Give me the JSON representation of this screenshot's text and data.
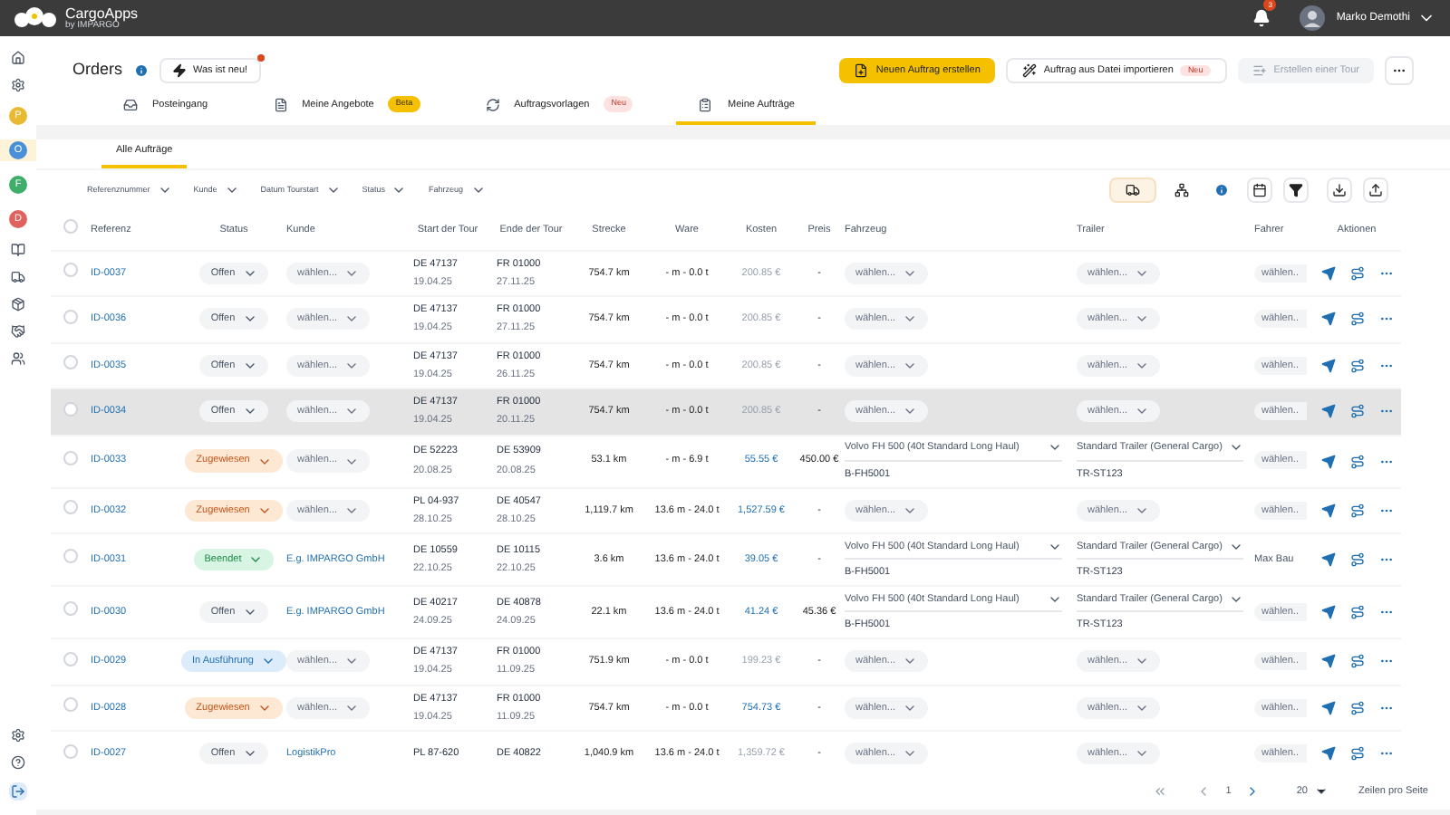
{
  "app": {
    "name": "CargoApps",
    "tagline": "by IMPARGO"
  },
  "notifications": {
    "count": "3"
  },
  "user": {
    "name": "Marko Demothi"
  },
  "sidebar": {
    "workspaces": [
      {
        "letter": "P",
        "color": "#e8b931",
        "selected": false
      },
      {
        "letter": "O",
        "color": "#4a90d9",
        "selected": true
      },
      {
        "letter": "F",
        "color": "#3fae6a",
        "selected": false
      },
      {
        "letter": "D",
        "color": "#e0625e",
        "selected": false
      }
    ]
  },
  "header": {
    "title": "Orders",
    "whats_new": "Was ist neu!",
    "new_order": "Neuen Auftrag erstellen",
    "import": {
      "label": "Auftrag aus Datei importieren",
      "badge": "Neu"
    },
    "create_tour": {
      "label": "Erstellen einer Tour",
      "disabled": true
    }
  },
  "tabs": [
    {
      "label": "Posteingang",
      "kind": "inbox",
      "selected": false
    },
    {
      "label": "Meine Angebote",
      "kind": "offers",
      "badge": {
        "text": "Beta",
        "kind": "beta"
      },
      "selected": false
    },
    {
      "label": "Auftragsvorlagen",
      "kind": "templates",
      "badge": {
        "text": "Neu",
        "kind": "new"
      },
      "selected": false
    },
    {
      "label": "Meine Aufträge",
      "kind": "orders",
      "selected": true
    }
  ],
  "subtabs": [
    {
      "label": "Alle Aufträge",
      "selected": true
    }
  ],
  "filters": [
    "Referenznummer",
    "Kunde",
    "Datum Tourstart",
    "Status",
    "Fahrzeug"
  ],
  "table": {
    "all_checked": false,
    "columns": [
      "Referenz",
      "Status",
      "Kunde",
      "Start der Tour",
      "Ende der Tour",
      "Strecke",
      "Ware",
      "Kosten",
      "Preis",
      "Fahrzeug",
      "Trailer",
      "Fahrer",
      "Aktionen"
    ],
    "rows": [
      {
        "checked": false,
        "ref": "ID-0037",
        "status": {
          "label": "Offen",
          "kind": "open"
        },
        "kunde": {
          "kind": "select",
          "text": "wählen..."
        },
        "start": [
          "DE 47137",
          "19.04.25"
        ],
        "end": [
          "FR 01000",
          "27.11.25"
        ],
        "strecke": "754.7 km",
        "ware": "- m - 0.0 t",
        "kosten": {
          "text": "200.85 €",
          "kind": "muted"
        },
        "preis": "-",
        "fahrzeug": {
          "kind": "select",
          "text": "wählen..."
        },
        "trailer": {
          "kind": "select",
          "text": "wählen..."
        },
        "fahrer": {
          "kind": "select",
          "text": "wählen.."
        },
        "highlighted": false
      },
      {
        "checked": false,
        "ref": "ID-0036",
        "status": {
          "label": "Offen",
          "kind": "open"
        },
        "kunde": {
          "kind": "select",
          "text": "wählen..."
        },
        "start": [
          "DE 47137",
          "19.04.25"
        ],
        "end": [
          "FR 01000",
          "27.11.25"
        ],
        "strecke": "754.7 km",
        "ware": "- m - 0.0 t",
        "kosten": {
          "text": "200.85 €",
          "kind": "muted"
        },
        "preis": "-",
        "fahrzeug": {
          "kind": "select",
          "text": "wählen..."
        },
        "trailer": {
          "kind": "select",
          "text": "wählen..."
        },
        "fahrer": {
          "kind": "select",
          "text": "wählen.."
        },
        "highlighted": false
      },
      {
        "checked": false,
        "ref": "ID-0035",
        "status": {
          "label": "Offen",
          "kind": "open"
        },
        "kunde": {
          "kind": "select",
          "text": "wählen..."
        },
        "start": [
          "DE 47137",
          "19.04.25"
        ],
        "end": [
          "FR 01000",
          "26.11.25"
        ],
        "strecke": "754.7 km",
        "ware": "- m - 0.0 t",
        "kosten": {
          "text": "200.85 €",
          "kind": "muted"
        },
        "preis": "-",
        "fahrzeug": {
          "kind": "select",
          "text": "wählen..."
        },
        "trailer": {
          "kind": "select",
          "text": "wählen..."
        },
        "fahrer": {
          "kind": "select",
          "text": "wählen.."
        },
        "highlighted": false
      },
      {
        "checked": false,
        "ref": "ID-0034",
        "status": {
          "label": "Offen",
          "kind": "open"
        },
        "kunde": {
          "kind": "select",
          "text": "wählen..."
        },
        "start": [
          "DE 47137",
          "19.04.25"
        ],
        "end": [
          "FR 01000",
          "20.11.25"
        ],
        "strecke": "754.7 km",
        "ware": "- m - 0.0 t",
        "kosten": {
          "text": "200.85 €",
          "kind": "muted"
        },
        "preis": "-",
        "fahrzeug": {
          "kind": "select",
          "text": "wählen..."
        },
        "trailer": {
          "kind": "select",
          "text": "wählen..."
        },
        "fahrer": {
          "kind": "select",
          "text": "wählen.."
        },
        "highlighted": true
      },
      {
        "checked": false,
        "ref": "ID-0033",
        "status": {
          "label": "Zugewiesen",
          "kind": "assigned"
        },
        "kunde": {
          "kind": "select",
          "text": "wählen..."
        },
        "start": [
          "DE 52223",
          "20.08.25"
        ],
        "end": [
          "DE 53909",
          "20.08.25"
        ],
        "strecke": "53.1 km",
        "ware": "- m - 6.9 t",
        "kosten": {
          "text": "55.55 €",
          "kind": "link"
        },
        "preis": "450.00 €",
        "fahrzeug": {
          "kind": "value",
          "text": "Volvo FH 500 (40t Standard Long Haul)",
          "plate": "B-FH5001"
        },
        "trailer": {
          "kind": "value",
          "text": "Standard Trailer (General Cargo)",
          "plate": "TR-ST123"
        },
        "fahrer": {
          "kind": "select",
          "text": "wählen.."
        },
        "highlighted": false
      },
      {
        "checked": false,
        "ref": "ID-0032",
        "status": {
          "label": "Zugewiesen",
          "kind": "assigned"
        },
        "kunde": {
          "kind": "select",
          "text": "wählen..."
        },
        "start": [
          "PL 04-937",
          "28.10.25"
        ],
        "end": [
          "DE 40547",
          "28.10.25"
        ],
        "strecke": "1,119.7 km",
        "ware": "13.6 m - 24.0 t",
        "kosten": {
          "text": "1,527.59 €",
          "kind": "link"
        },
        "preis": "-",
        "fahrzeug": {
          "kind": "select",
          "text": "wählen..."
        },
        "trailer": {
          "kind": "select",
          "text": "wählen..."
        },
        "fahrer": {
          "kind": "select",
          "text": "wählen.."
        },
        "highlighted": false
      },
      {
        "checked": false,
        "ref": "ID-0031",
        "status": {
          "label": "Beendet",
          "kind": "done"
        },
        "kunde": {
          "kind": "link",
          "text": "E.g. IMPARGO GmbH"
        },
        "start": [
          "DE 10559",
          "22.10.25"
        ],
        "end": [
          "DE 10115",
          "22.10.25"
        ],
        "strecke": "3.6 km",
        "ware": "13.6 m - 24.0 t",
        "kosten": {
          "text": "39.05 €",
          "kind": "link"
        },
        "preis": "-",
        "fahrzeug": {
          "kind": "value",
          "text": "Volvo FH 500 (40t Standard Long Haul)",
          "plate": "B-FH5001"
        },
        "trailer": {
          "kind": "value",
          "text": "Standard Trailer (General Cargo)",
          "plate": "TR-ST123"
        },
        "fahrer": {
          "kind": "value",
          "text": "Max Bau"
        },
        "highlighted": false
      },
      {
        "checked": false,
        "ref": "ID-0030",
        "status": {
          "label": "Offen",
          "kind": "open"
        },
        "kunde": {
          "kind": "link",
          "text": "E.g. IMPARGO GmbH"
        },
        "start": [
          "DE 40217",
          "24.09.25"
        ],
        "end": [
          "DE 40878",
          "24.09.25"
        ],
        "strecke": "22.1 km",
        "ware": "13.6 m - 24.0 t",
        "kosten": {
          "text": "41.24 €",
          "kind": "link"
        },
        "preis": "45.36 €",
        "fahrzeug": {
          "kind": "value",
          "text": "Volvo FH 500 (40t Standard Long Haul)",
          "plate": "B-FH5001"
        },
        "trailer": {
          "kind": "value",
          "text": "Standard Trailer (General Cargo)",
          "plate": "TR-ST123"
        },
        "fahrer": {
          "kind": "select",
          "text": "wählen.."
        },
        "highlighted": false
      },
      {
        "checked": false,
        "ref": "ID-0029",
        "status": {
          "label": "In Ausführung",
          "kind": "running"
        },
        "kunde": {
          "kind": "select",
          "text": "wählen..."
        },
        "start": [
          "DE 47137",
          "19.04.25"
        ],
        "end": [
          "FR 01000",
          "11.09.25"
        ],
        "strecke": "751.9 km",
        "ware": "- m - 0.0 t",
        "kosten": {
          "text": "199.23 €",
          "kind": "muted"
        },
        "preis": "-",
        "fahrzeug": {
          "kind": "select",
          "text": "wählen..."
        },
        "trailer": {
          "kind": "select",
          "text": "wählen..."
        },
        "fahrer": {
          "kind": "select",
          "text": "wählen.."
        },
        "highlighted": false
      },
      {
        "checked": false,
        "ref": "ID-0028",
        "status": {
          "label": "Zugewiesen",
          "kind": "assigned"
        },
        "kunde": {
          "kind": "select",
          "text": "wählen..."
        },
        "start": [
          "DE 47137",
          "19.04.25"
        ],
        "end": [
          "FR 01000",
          "11.09.25"
        ],
        "strecke": "754.7 km",
        "ware": "- m - 0.0 t",
        "kosten": {
          "text": "754.73 €",
          "kind": "link"
        },
        "preis": "-",
        "fahrzeug": {
          "kind": "select",
          "text": "wählen..."
        },
        "trailer": {
          "kind": "select",
          "text": "wählen..."
        },
        "fahrer": {
          "kind": "select",
          "text": "wählen.."
        },
        "highlighted": false
      },
      {
        "checked": false,
        "ref": "ID-0027",
        "status": {
          "label": "Offen",
          "kind": "open"
        },
        "kunde": {
          "kind": "link",
          "text": "LogistikPro"
        },
        "start": [
          "PL 87-620"
        ],
        "end": [
          "DE 40822"
        ],
        "strecke": "1,040.9 km",
        "ware": "13.6 m - 24.0 t",
        "kosten": {
          "text": "1,359.72 €",
          "kind": "muted"
        },
        "preis": "-",
        "fahrzeug": {
          "kind": "select",
          "text": "wählen..."
        },
        "trailer": {
          "kind": "select",
          "text": "wählen..."
        },
        "fahrer": {
          "kind": "select",
          "text": "wählen.."
        },
        "highlighted": false
      }
    ]
  },
  "pagination": {
    "page": "1",
    "page_size": "20",
    "page_size_label": "Zeilen pro Seite"
  }
}
